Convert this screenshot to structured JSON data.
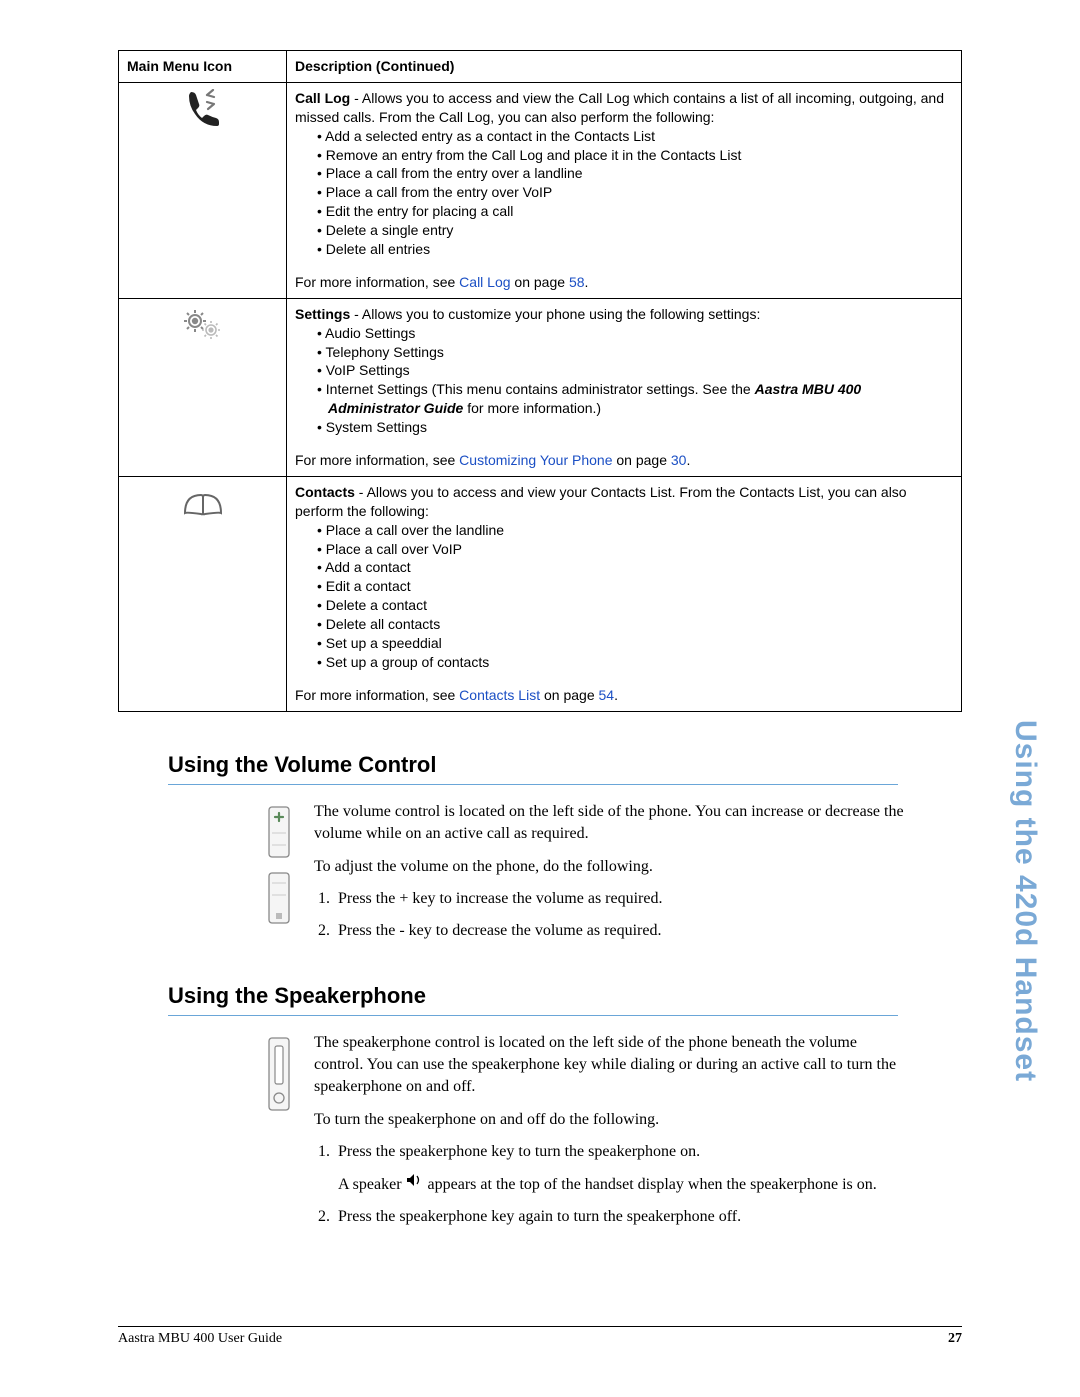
{
  "table": {
    "header_icon": "Main Menu Icon",
    "header_desc": "Description (Continued)",
    "rows": [
      {
        "title": "Call Log",
        "intro": " - Allows you to access and view the Call Log which contains a list of all incoming, outgoing, and missed calls. From the Call Log, you can also perform the following:",
        "bullets": [
          "Add a selected entry as a contact in the Contacts List",
          "Remove an entry from the Call Log and place it in the Contacts List",
          "Place a call from the entry over a landline",
          "Place a call from the entry over VoIP",
          "Edit the entry for placing a call",
          "Delete a single entry",
          "Delete all entries"
        ],
        "link_prefix": "For more information, see ",
        "link_text": "Call Log",
        "link_suffix": " on page ",
        "link_page": "58",
        "dot": "."
      },
      {
        "title": "Settings",
        "intro": " - Allows you to customize your phone using the following settings:",
        "bullets": [
          "Audio Settings",
          "Telephony Settings",
          "VoIP Settings"
        ],
        "internet_prefix": "Internet Settings (This menu contains administrator settings. See the ",
        "internet_bold": "Aastra MBU 400 Administrator Guide",
        "internet_suffix": " for more information.)",
        "bullets2": [
          "System Settings"
        ],
        "link_prefix": "For more information, see ",
        "link_text": "Customizing Your Phone",
        "link_suffix": " on page ",
        "link_page": "30",
        "dot": "."
      },
      {
        "title": "Contacts",
        "intro": " - Allows you to access and view your Contacts List.    From the Contacts List, you can also perform the following:",
        "bullets": [
          "Place a call over the landline",
          "Place a call over VoIP",
          "Add a contact",
          "Edit a contact",
          "Delete a contact",
          "Delete all contacts",
          "Set up a speeddial",
          "Set up a group of contacts"
        ],
        "link_prefix": "For more information, see ",
        "link_text": "Contacts List",
        "link_suffix": " on page ",
        "link_page": "54",
        "dot": "."
      }
    ]
  },
  "section1": {
    "heading": "Using the Volume Control",
    "p1": "The volume control is located on the left side of the phone. You can increase or decrease the volume while on an active call as required.",
    "p2": "To adjust the volume on the phone, do the following.",
    "step1": "Press the + key to increase the volume as required.",
    "step2": "Press the - key to decrease the volume as required."
  },
  "section2": {
    "heading": "Using the Speakerphone",
    "p1": "The speakerphone control is located on the left side of the phone beneath the volume control. You can use the speakerphone key while dialing or during an active call to turn the speakerphone on and off.",
    "p2": "To turn the speakerphone on and off do the following.",
    "step1": "Press the speakerphone key to turn the speakerphone on.",
    "step1b_a": "A speaker ",
    "step1b_b": " appears at the top of the handset display when the speakerphone is on.",
    "step2": "Press the speakerphone key again to turn the speakerphone off."
  },
  "side": "Using the 420d Handset",
  "footer_left": "Aastra MBU 400 User Guide",
  "footer_right": "27"
}
